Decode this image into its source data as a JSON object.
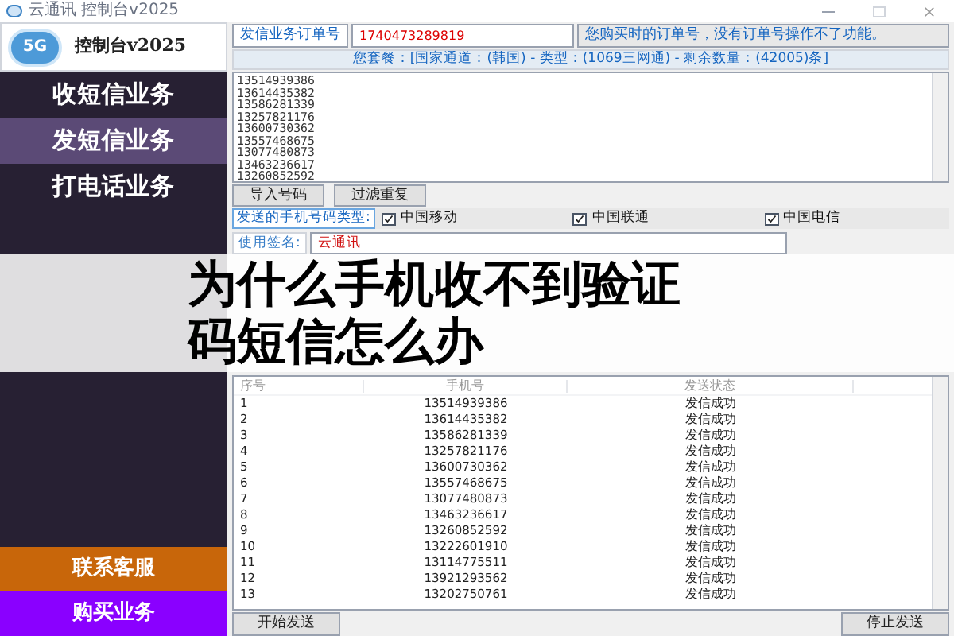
{
  "window": {
    "title": "云通讯 控制台v2025",
    "logo_text": "5G",
    "brand": "控制台v2025"
  },
  "sidebar": {
    "items": [
      {
        "label": "收短信业务",
        "selected": false
      },
      {
        "label": "发短信业务",
        "selected": true
      },
      {
        "label": "打电话业务",
        "selected": false
      }
    ],
    "bottom_buttons": [
      {
        "label": "联系客服",
        "color": "#c8660a"
      },
      {
        "label": "购买业务",
        "color": "#8a00ff"
      }
    ]
  },
  "order": {
    "label": "发信业务订单号",
    "value": "1740473289819",
    "hint": "您购买时的订单号，没有订单号操作不了功能。"
  },
  "package": "您套餐：[国家通道：(韩国) - 类型：(1069三网通) - 剩余数量：(42005)条]",
  "numbers": [
    "13514939386",
    "13614435382",
    "13586281339",
    "13257821176",
    "13600730362",
    "13557468675",
    "13077480873",
    "13463236617",
    "13260852592"
  ],
  "number_buttons": [
    "导入号码",
    "过滤重复"
  ],
  "carriers": {
    "label": "发送的手机号码类型:",
    "items": [
      {
        "label": "中国移动",
        "checked": true
      },
      {
        "label": "中国联通",
        "checked": true
      },
      {
        "label": "中国电信",
        "checked": true
      }
    ]
  },
  "signature": {
    "label": "使用签名:",
    "value": "云通讯"
  },
  "table": {
    "columns": [
      "序号",
      "手机号",
      "发送状态"
    ],
    "rows": [
      [
        "1",
        "13514939386",
        "发信成功"
      ],
      [
        "2",
        "13614435382",
        "发信成功"
      ],
      [
        "3",
        "13586281339",
        "发信成功"
      ],
      [
        "4",
        "13257821176",
        "发信成功"
      ],
      [
        "5",
        "13600730362",
        "发信成功"
      ],
      [
        "6",
        "13557468675",
        "发信成功"
      ],
      [
        "7",
        "13077480873",
        "发信成功"
      ],
      [
        "8",
        "13463236617",
        "发信成功"
      ],
      [
        "9",
        "13260852592",
        "发信成功"
      ],
      [
        "10",
        "13222601910",
        "发信成功"
      ],
      [
        "11",
        "13114775511",
        "发信成功"
      ],
      [
        "12",
        "13921293562",
        "发信成功"
      ],
      [
        "13",
        "13202750761",
        "发信成功"
      ]
    ]
  },
  "actions": [
    "开始发送",
    "停止发送"
  ],
  "banner": "为什么手机收不到验证码短信怎么办"
}
